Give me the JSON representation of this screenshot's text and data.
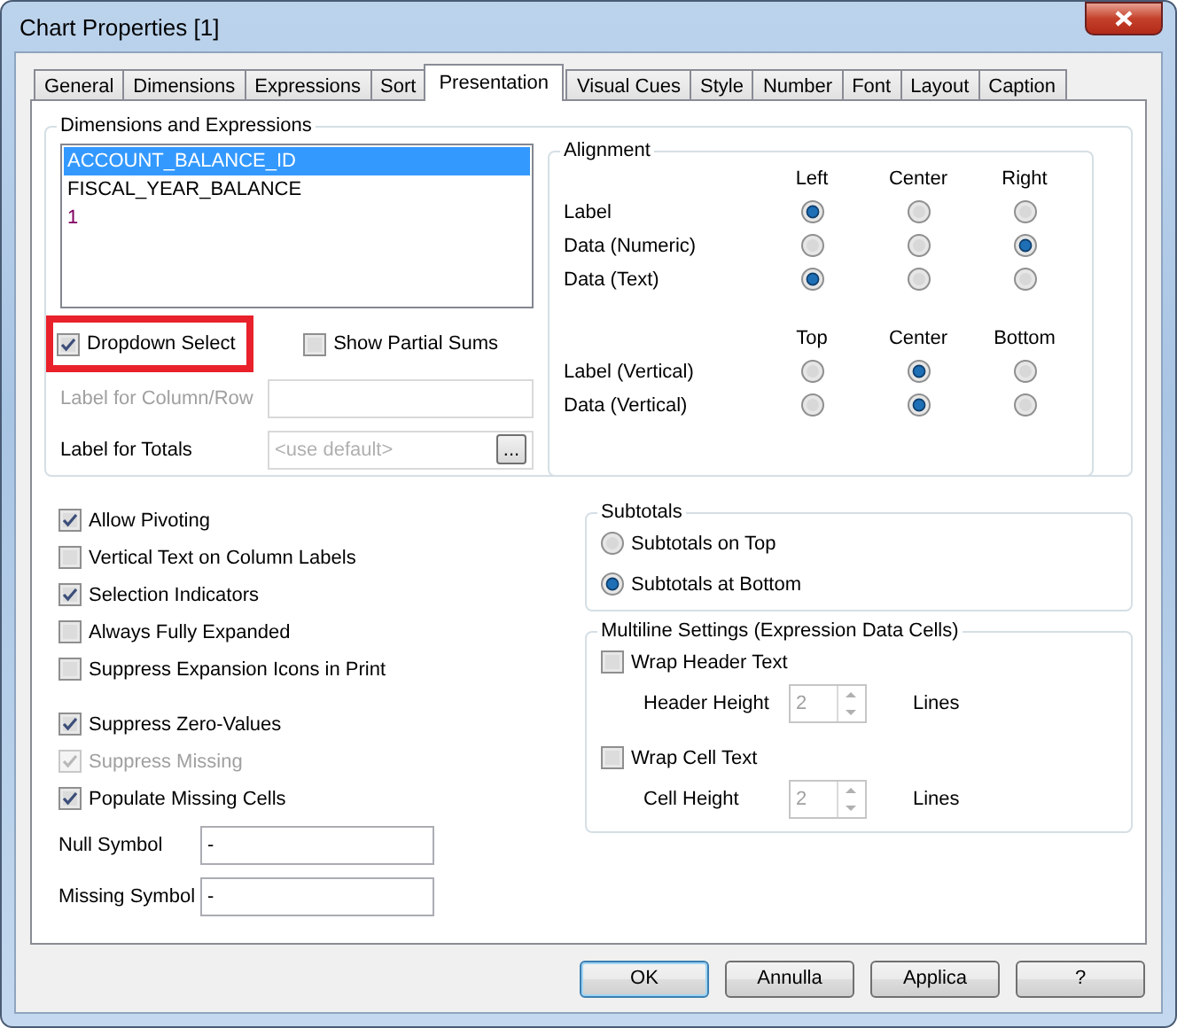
{
  "window": {
    "title": "Chart Properties [1]"
  },
  "tabs": [
    {
      "label": "General",
      "selected": false
    },
    {
      "label": "Dimensions",
      "selected": false
    },
    {
      "label": "Expressions",
      "selected": false
    },
    {
      "label": "Sort",
      "selected": false
    },
    {
      "label": "Presentation",
      "selected": true
    },
    {
      "label": "Visual Cues",
      "selected": false
    },
    {
      "label": "Style",
      "selected": false
    },
    {
      "label": "Number",
      "selected": false
    },
    {
      "label": "Font",
      "selected": false
    },
    {
      "label": "Layout",
      "selected": false
    },
    {
      "label": "Caption",
      "selected": false
    }
  ],
  "dimensions_and_expressions": {
    "title": "Dimensions and Expressions",
    "items": [
      {
        "label": "ACCOUNT_BALANCE_ID",
        "kind": "dimension",
        "selected": true
      },
      {
        "label": "FISCAL_YEAR_BALANCE",
        "kind": "dimension",
        "selected": false
      },
      {
        "label": "1",
        "kind": "expression",
        "selected": false
      }
    ],
    "dropdown_select": {
      "label": "Dropdown Select",
      "checked": true,
      "highlighted": true
    },
    "show_partial_sums": {
      "label": "Show Partial Sums",
      "checked": false,
      "highlighted": false
    },
    "label_for_column_row": {
      "label": "Label for Column/Row",
      "disabled": true
    },
    "label_for_totals": {
      "label": "Label for Totals",
      "placeholder": "<use default>",
      "button": "..."
    }
  },
  "alignment": {
    "title": "Alignment",
    "horizontal": {
      "columns": [
        "Left",
        "Center",
        "Right"
      ],
      "rows": [
        {
          "label": "Label",
          "options": [
            {
              "selected": true
            },
            {
              "selected": false
            },
            {
              "selected": false
            }
          ]
        },
        {
          "label": "Data (Numeric)",
          "options": [
            {
              "selected": false
            },
            {
              "selected": false
            },
            {
              "selected": true
            }
          ]
        },
        {
          "label": "Data (Text)",
          "options": [
            {
              "selected": true
            },
            {
              "selected": false
            },
            {
              "selected": false
            }
          ]
        }
      ]
    },
    "vertical": {
      "columns": [
        "Top",
        "Center",
        "Bottom"
      ],
      "rows": [
        {
          "label": "Label (Vertical)",
          "options": [
            {
              "selected": false
            },
            {
              "selected": true
            },
            {
              "selected": false
            }
          ]
        },
        {
          "label": "Data (Vertical)",
          "options": [
            {
              "selected": false
            },
            {
              "selected": true
            },
            {
              "selected": false
            }
          ]
        }
      ]
    }
  },
  "option_groups": [
    {
      "items": [
        {
          "label": "Allow Pivoting",
          "checked": true,
          "disabled": false
        },
        {
          "label": "Vertical Text on Column Labels",
          "checked": false,
          "disabled": false
        },
        {
          "label": "Selection Indicators",
          "checked": true,
          "disabled": false
        },
        {
          "label": "Always Fully Expanded",
          "checked": false,
          "disabled": false
        },
        {
          "label": "Suppress Expansion Icons in Print",
          "checked": false,
          "disabled": false
        }
      ]
    },
    {
      "items": [
        {
          "label": "Suppress Zero-Values",
          "checked": true,
          "disabled": false
        },
        {
          "label": "Suppress Missing",
          "checked": true,
          "disabled": true
        },
        {
          "label": "Populate Missing Cells",
          "checked": true,
          "disabled": false
        }
      ]
    }
  ],
  "symbols": [
    {
      "label": "Null Symbol",
      "value": "-"
    },
    {
      "label": "Missing Symbol",
      "value": "-"
    }
  ],
  "subtotals": {
    "title": "Subtotals",
    "options": [
      {
        "label": "Subtotals on Top",
        "selected": false
      },
      {
        "label": "Subtotals at Bottom",
        "selected": true
      }
    ]
  },
  "multiline_settings": {
    "title": "Multiline Settings (Expression Data Cells)",
    "items": [
      {
        "label": "Wrap Header Text",
        "checked": false,
        "height_label": "Header Height",
        "value": "2",
        "unit": "Lines",
        "disabled": true
      },
      {
        "label": "Wrap Cell Text",
        "checked": false,
        "height_label": "Cell Height",
        "value": "2",
        "unit": "Lines",
        "disabled": true
      }
    ]
  },
  "buttons": [
    {
      "label": "OK",
      "default": true
    },
    {
      "label": "Annulla",
      "default": false
    },
    {
      "label": "Applica",
      "default": false
    },
    {
      "label": "?",
      "default": false
    }
  ]
}
